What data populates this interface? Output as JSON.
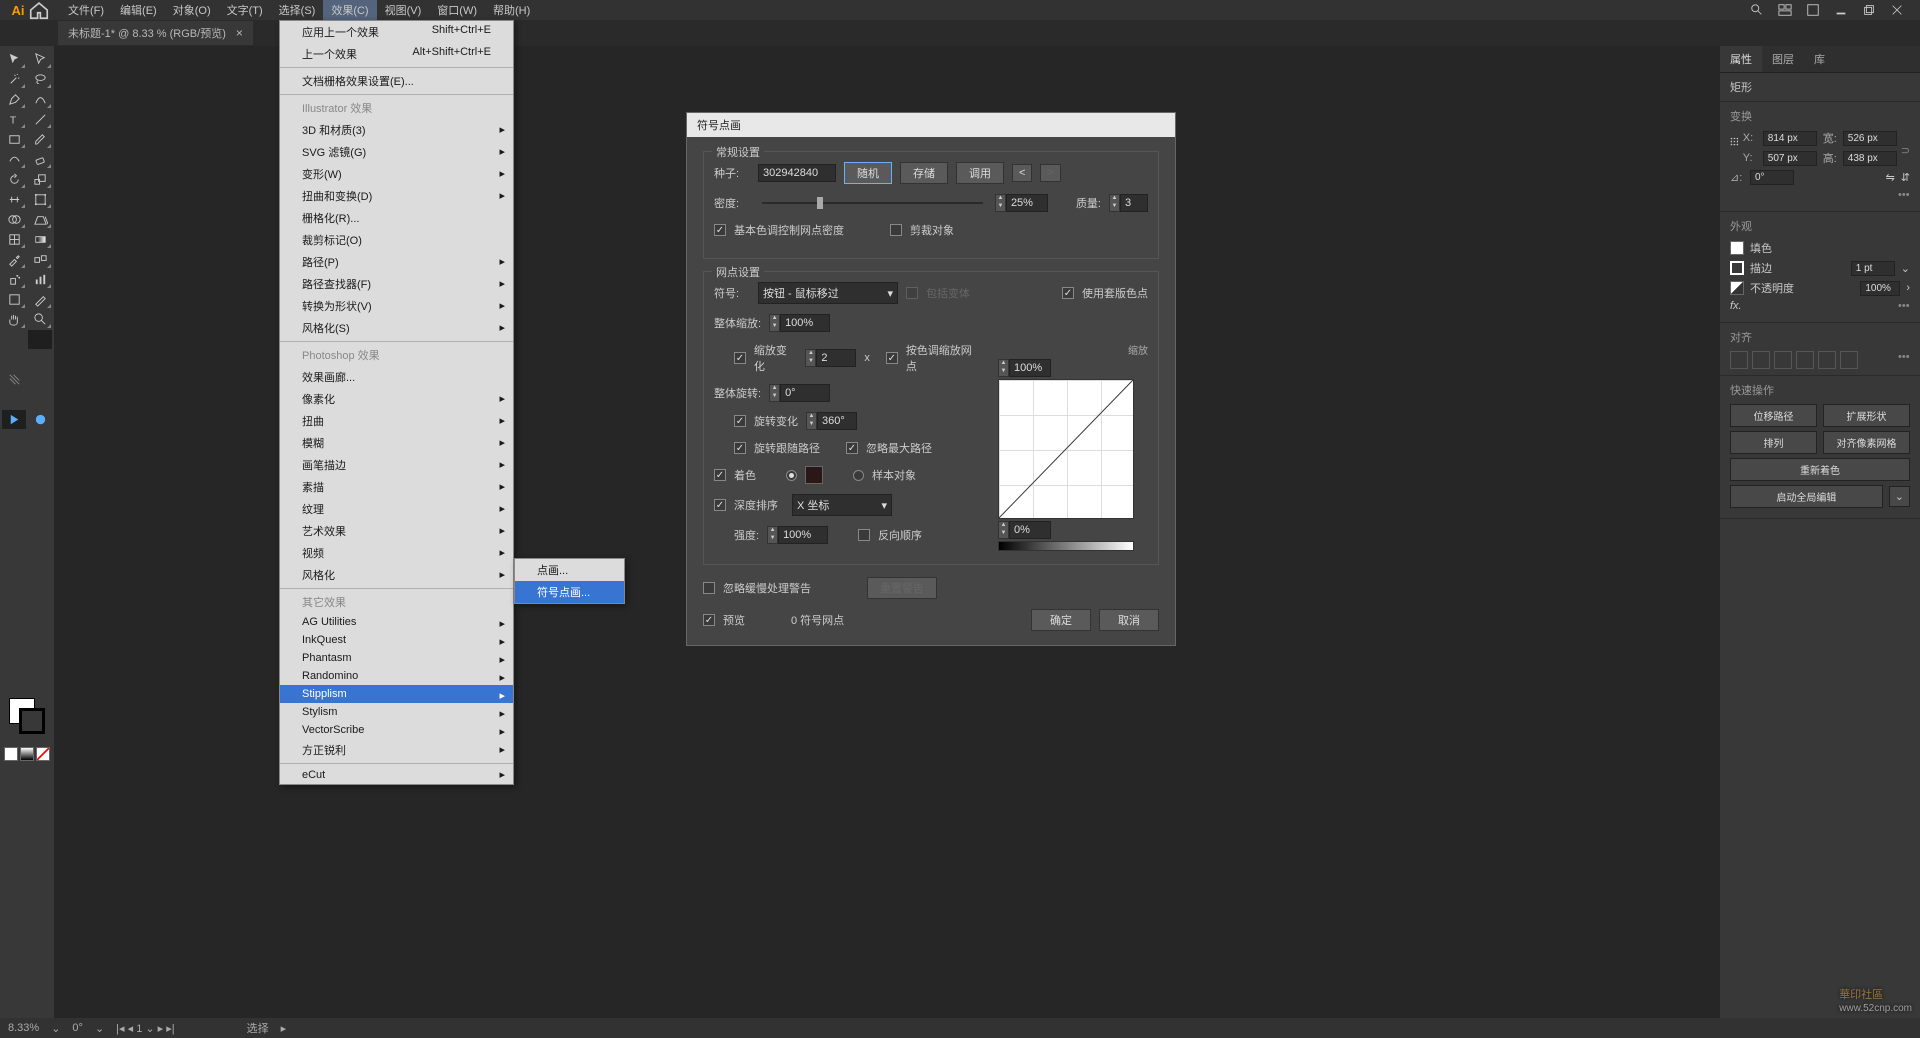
{
  "app": {
    "logo": "Ai"
  },
  "menu": {
    "items": [
      "文件(F)",
      "编辑(E)",
      "对象(O)",
      "文字(T)",
      "选择(S)",
      "效果(C)",
      "视图(V)",
      "窗口(W)",
      "帮助(H)"
    ],
    "active_index": 5
  },
  "tab": {
    "title": "未标题-1* @ 8.33 % (RGB/预览)"
  },
  "effects_menu": {
    "top": [
      {
        "label": "应用上一个效果",
        "accel": "Shift+Ctrl+E"
      },
      {
        "label": "上一个效果",
        "accel": "Alt+Shift+Ctrl+E"
      }
    ],
    "doc_raster": "文档栅格效果设置(E)...",
    "illustrator_header": "Illustrator 效果",
    "illustrator": [
      "3D 和材质(3)",
      "SVG 滤镜(G)",
      "变形(W)",
      "扭曲和变换(D)",
      "栅格化(R)...",
      "裁剪标记(O)",
      "路径(P)",
      "路径查找器(F)",
      "转换为形状(V)",
      "风格化(S)"
    ],
    "photoshop_header": "Photoshop 效果",
    "photoshop": [
      "效果画廊...",
      "像素化",
      "扭曲",
      "模糊",
      "画笔描边",
      "素描",
      "纹理",
      "艺术效果",
      "视频",
      "风格化"
    ],
    "other_header": "其它效果",
    "other": [
      "AG Utilities",
      "InkQuest",
      "Phantasm",
      "Randomino",
      "Stipplism",
      "Stylism",
      "VectorScribe",
      "方正锐利"
    ],
    "ecut": "eCut",
    "stipplism_index": 4
  },
  "submenu": {
    "items": [
      "点画...",
      "符号点画..."
    ],
    "hl_index": 1
  },
  "dialog": {
    "title": "符号点画",
    "group1": "常规设置",
    "seed_label": "种子:",
    "seed": "302942840",
    "btn_random": "随机",
    "btn_save": "存储",
    "btn_load": "调用",
    "btn_lt": "<",
    "btn_gt": ">",
    "density_label": "密度:",
    "density": "25%",
    "quality_label": "质量:",
    "quality": "3",
    "chk_tint_density": "基本色调控制网点密度",
    "chk_crop": "剪裁对象",
    "group2": "网点设置",
    "symbol_label": "符号:",
    "symbol_value": "按钮 - 鼠标移过",
    "chk_include_variants": "包括变体",
    "chk_plate": "使用套版色点",
    "overall_scale_label": "整体缩放:",
    "overall_scale": "100%",
    "chk_scale_var": "缩放变化",
    "scale_var": "2",
    "scale_x": "x",
    "chk_color_scale": "按色调缩放网点",
    "overall_rotate_label": "整体旋转:",
    "overall_rotate": "0°",
    "curve_top": "100%",
    "chk_rotate_var": "旋转变化",
    "rotate_var": "360°",
    "chk_follow_path": "旋转跟随路径",
    "chk_ignore_max": "忽略最大路径",
    "scale_caption": "缩放",
    "chk_tint": "着色",
    "tint_radio_color": "",
    "chk_sample_obj": "样本对象",
    "chk_depth_sort": "深度排序",
    "sort_by": "X 坐标",
    "curve_bottom": "0%",
    "strength_label": "强度:",
    "strength": "100%",
    "chk_reverse": "反向顺序",
    "chk_ignore_slow": "忽略缓慢处理警告",
    "btn_reset_warn": "重置警告",
    "chk_preview": "预览",
    "dots_count": "0 符号网点",
    "btn_ok": "确定",
    "btn_cancel": "取消"
  },
  "panels": {
    "tabs": [
      "属性",
      "图层",
      "库"
    ],
    "shape_header": "矩形",
    "transform": "变换",
    "x_label": "X:",
    "x": "814 px",
    "w_label": "宽:",
    "w": "526 px",
    "y_label": "Y:",
    "y": "507 px",
    "h_label": "高:",
    "h": "438 px",
    "angle_label": "⊿:",
    "angle": "0°",
    "appearance": "外观",
    "fill": "填色",
    "stroke": "描边",
    "stroke_w": "1 pt",
    "opacity_label": "不透明度",
    "opacity": "100%",
    "fx": "fx.",
    "align": "对齐",
    "quick": "快速操作",
    "q1": "位移路径",
    "q2": "扩展形状",
    "q3": "排列",
    "q4": "对齐像素网格",
    "q5": "重新着色",
    "q6": "启动全局编辑"
  },
  "status": {
    "zoom": "8.33%",
    "angle": "0°",
    "artboard": "1",
    "tool": "选择"
  },
  "watermark": {
    "main": "華印社區",
    "sub": "www.52cnp.com"
  }
}
